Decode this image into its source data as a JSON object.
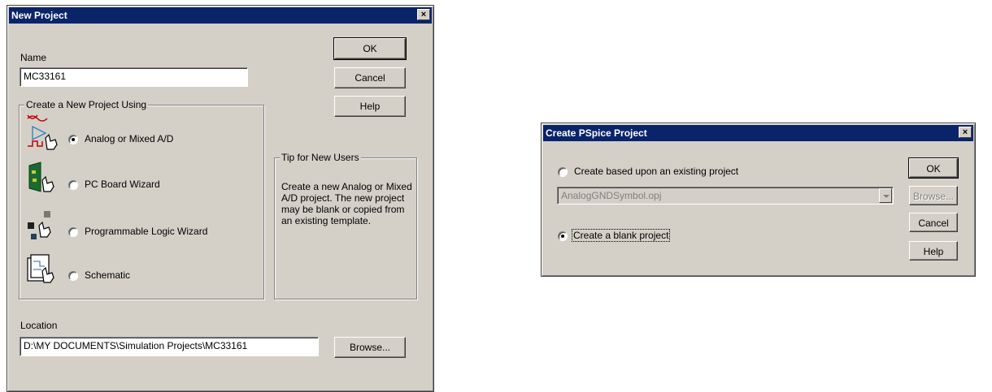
{
  "new_project": {
    "title": "New Project",
    "close": "×",
    "name_label": "Name",
    "name_value": "MC33161",
    "group_title": "Create a New Project Using",
    "options": [
      {
        "label": "Analog or Mixed A/D",
        "selected": true
      },
      {
        "label": "PC Board Wizard",
        "selected": false
      },
      {
        "label": "Programmable Logic Wizard",
        "selected": false
      },
      {
        "label": "Schematic",
        "selected": false
      }
    ],
    "tip_title": "Tip for New Users",
    "tip_text": "Create a new Analog or Mixed A/D project.  The new project may be blank or copied from an existing template.",
    "location_label": "Location",
    "location_value": "D:\\MY DOCUMENTS\\Simulation Projects\\MC33161",
    "buttons": {
      "ok": "OK",
      "cancel": "Cancel",
      "help": "Help",
      "browse": "Browse..."
    }
  },
  "pspice": {
    "title": "Create PSpice Project",
    "close": "×",
    "option_existing": "Create based upon an existing project",
    "existing_value": "AnalogGNDSymbol.opj",
    "option_blank": "Create a blank project",
    "selected": "blank",
    "buttons": {
      "ok": "OK",
      "browse": "Browse...",
      "cancel": "Cancel",
      "help": "Help"
    }
  }
}
